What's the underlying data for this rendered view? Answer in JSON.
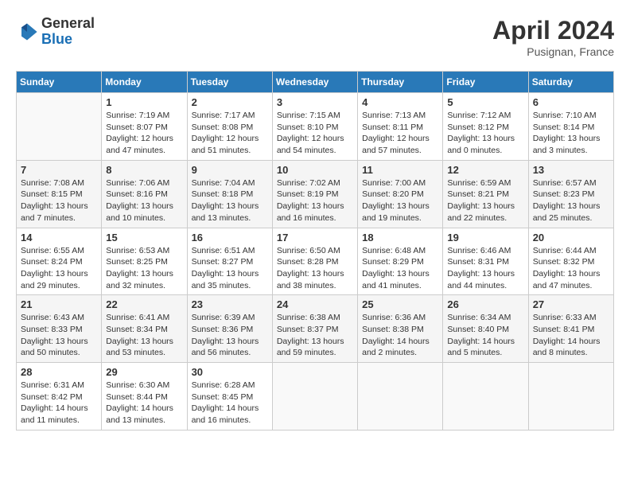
{
  "header": {
    "logo_general": "General",
    "logo_blue": "Blue",
    "month_year": "April 2024",
    "location": "Pusignan, France"
  },
  "columns": [
    "Sunday",
    "Monday",
    "Tuesday",
    "Wednesday",
    "Thursday",
    "Friday",
    "Saturday"
  ],
  "weeks": [
    [
      {
        "day": "",
        "info": ""
      },
      {
        "day": "1",
        "info": "Sunrise: 7:19 AM\nSunset: 8:07 PM\nDaylight: 12 hours\nand 47 minutes."
      },
      {
        "day": "2",
        "info": "Sunrise: 7:17 AM\nSunset: 8:08 PM\nDaylight: 12 hours\nand 51 minutes."
      },
      {
        "day": "3",
        "info": "Sunrise: 7:15 AM\nSunset: 8:10 PM\nDaylight: 12 hours\nand 54 minutes."
      },
      {
        "day": "4",
        "info": "Sunrise: 7:13 AM\nSunset: 8:11 PM\nDaylight: 12 hours\nand 57 minutes."
      },
      {
        "day": "5",
        "info": "Sunrise: 7:12 AM\nSunset: 8:12 PM\nDaylight: 13 hours\nand 0 minutes."
      },
      {
        "day": "6",
        "info": "Sunrise: 7:10 AM\nSunset: 8:14 PM\nDaylight: 13 hours\nand 3 minutes."
      }
    ],
    [
      {
        "day": "7",
        "info": "Sunrise: 7:08 AM\nSunset: 8:15 PM\nDaylight: 13 hours\nand 7 minutes."
      },
      {
        "day": "8",
        "info": "Sunrise: 7:06 AM\nSunset: 8:16 PM\nDaylight: 13 hours\nand 10 minutes."
      },
      {
        "day": "9",
        "info": "Sunrise: 7:04 AM\nSunset: 8:18 PM\nDaylight: 13 hours\nand 13 minutes."
      },
      {
        "day": "10",
        "info": "Sunrise: 7:02 AM\nSunset: 8:19 PM\nDaylight: 13 hours\nand 16 minutes."
      },
      {
        "day": "11",
        "info": "Sunrise: 7:00 AM\nSunset: 8:20 PM\nDaylight: 13 hours\nand 19 minutes."
      },
      {
        "day": "12",
        "info": "Sunrise: 6:59 AM\nSunset: 8:21 PM\nDaylight: 13 hours\nand 22 minutes."
      },
      {
        "day": "13",
        "info": "Sunrise: 6:57 AM\nSunset: 8:23 PM\nDaylight: 13 hours\nand 25 minutes."
      }
    ],
    [
      {
        "day": "14",
        "info": "Sunrise: 6:55 AM\nSunset: 8:24 PM\nDaylight: 13 hours\nand 29 minutes."
      },
      {
        "day": "15",
        "info": "Sunrise: 6:53 AM\nSunset: 8:25 PM\nDaylight: 13 hours\nand 32 minutes."
      },
      {
        "day": "16",
        "info": "Sunrise: 6:51 AM\nSunset: 8:27 PM\nDaylight: 13 hours\nand 35 minutes."
      },
      {
        "day": "17",
        "info": "Sunrise: 6:50 AM\nSunset: 8:28 PM\nDaylight: 13 hours\nand 38 minutes."
      },
      {
        "day": "18",
        "info": "Sunrise: 6:48 AM\nSunset: 8:29 PM\nDaylight: 13 hours\nand 41 minutes."
      },
      {
        "day": "19",
        "info": "Sunrise: 6:46 AM\nSunset: 8:31 PM\nDaylight: 13 hours\nand 44 minutes."
      },
      {
        "day": "20",
        "info": "Sunrise: 6:44 AM\nSunset: 8:32 PM\nDaylight: 13 hours\nand 47 minutes."
      }
    ],
    [
      {
        "day": "21",
        "info": "Sunrise: 6:43 AM\nSunset: 8:33 PM\nDaylight: 13 hours\nand 50 minutes."
      },
      {
        "day": "22",
        "info": "Sunrise: 6:41 AM\nSunset: 8:34 PM\nDaylight: 13 hours\nand 53 minutes."
      },
      {
        "day": "23",
        "info": "Sunrise: 6:39 AM\nSunset: 8:36 PM\nDaylight: 13 hours\nand 56 minutes."
      },
      {
        "day": "24",
        "info": "Sunrise: 6:38 AM\nSunset: 8:37 PM\nDaylight: 13 hours\nand 59 minutes."
      },
      {
        "day": "25",
        "info": "Sunrise: 6:36 AM\nSunset: 8:38 PM\nDaylight: 14 hours\nand 2 minutes."
      },
      {
        "day": "26",
        "info": "Sunrise: 6:34 AM\nSunset: 8:40 PM\nDaylight: 14 hours\nand 5 minutes."
      },
      {
        "day": "27",
        "info": "Sunrise: 6:33 AM\nSunset: 8:41 PM\nDaylight: 14 hours\nand 8 minutes."
      }
    ],
    [
      {
        "day": "28",
        "info": "Sunrise: 6:31 AM\nSunset: 8:42 PM\nDaylight: 14 hours\nand 11 minutes."
      },
      {
        "day": "29",
        "info": "Sunrise: 6:30 AM\nSunset: 8:44 PM\nDaylight: 14 hours\nand 13 minutes."
      },
      {
        "day": "30",
        "info": "Sunrise: 6:28 AM\nSunset: 8:45 PM\nDaylight: 14 hours\nand 16 minutes."
      },
      {
        "day": "",
        "info": ""
      },
      {
        "day": "",
        "info": ""
      },
      {
        "day": "",
        "info": ""
      },
      {
        "day": "",
        "info": ""
      }
    ]
  ]
}
